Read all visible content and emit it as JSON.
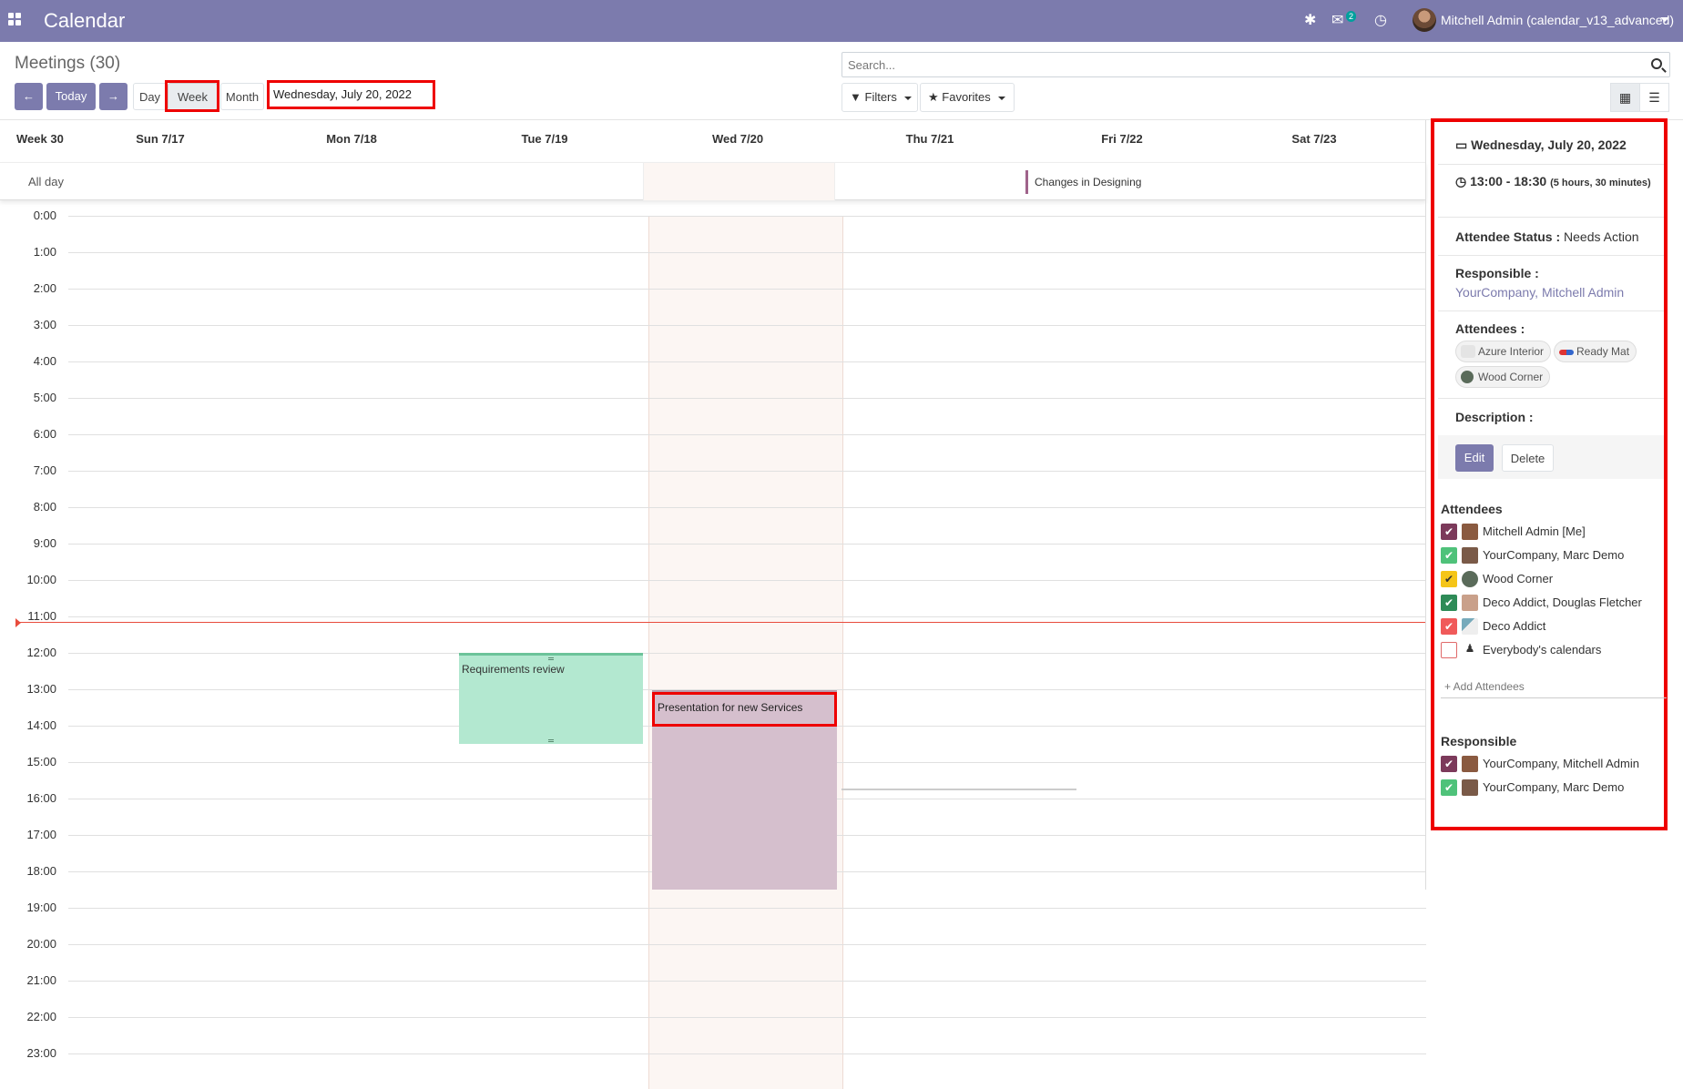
{
  "topbar": {
    "app_name": "Calendar",
    "chat_count": "2",
    "user_name": "Mitchell Admin (calendar_v13_advanced)"
  },
  "control_panel": {
    "title": "Meetings (30)",
    "today_label": "Today",
    "view_day": "Day",
    "view_week": "Week",
    "view_month": "Month",
    "current_date": "Wednesday, July 20, 2022",
    "search_placeholder": "Search...",
    "filters_label": "Filters",
    "favorites_label": "Favorites"
  },
  "calendar": {
    "week_label": "Week 30",
    "days": [
      "Sun 7/17",
      "Mon 7/18",
      "Tue 7/19",
      "Wed 7/20",
      "Thu 7/21",
      "Fri 7/22",
      "Sat 7/23"
    ],
    "allday_label": "All day",
    "allday_event": "Changes in Designing",
    "hours": [
      "0:00",
      "1:00",
      "2:00",
      "3:00",
      "4:00",
      "5:00",
      "6:00",
      "7:00",
      "8:00",
      "9:00",
      "10:00",
      "11:00",
      "12:00",
      "13:00",
      "14:00",
      "15:00",
      "16:00",
      "17:00",
      "18:00",
      "19:00",
      "20:00",
      "21:00",
      "22:00",
      "23:00"
    ],
    "events": {
      "green": "Requirements review",
      "purple": "Presentation for new Services"
    }
  },
  "popover": {
    "date": "Wednesday, July 20, 2022",
    "time": "13:00 - 18:30",
    "duration": "(5 hours, 30 minutes)",
    "status_label": "Attendee Status :",
    "status_value": "Needs Action",
    "responsible_label": "Responsible :",
    "responsible_value": "YourCompany, Mitchell Admin",
    "attendees_label": "Attendees :",
    "attendee_tags": [
      "Azure Interior",
      "Ready Mat",
      "Wood Corner"
    ],
    "description_label": "Description :",
    "edit_label": "Edit",
    "delete_label": "Delete"
  },
  "sidebar": {
    "attendees_title": "Attendees",
    "attendees": [
      {
        "name": "Mitchell Admin [Me]",
        "color": "#7c3a5b"
      },
      {
        "name": "YourCompany, Marc Demo",
        "color": "#4fc27a"
      },
      {
        "name": "Wood Corner",
        "color": "#f5c518"
      },
      {
        "name": "Deco Addict, Douglas Fletcher",
        "color": "#2e8b57"
      },
      {
        "name": "Deco Addict",
        "color": "#f05a5a"
      },
      {
        "name": "Everybody's calendars",
        "color": "#ffffff"
      }
    ],
    "add_attendees": "+ Add Attendees",
    "responsible_title": "Responsible",
    "responsible": [
      {
        "name": "YourCompany, Mitchell Admin",
        "color": "#7c3a5b"
      },
      {
        "name": "YourCompany, Marc Demo",
        "color": "#4fc27a"
      }
    ]
  }
}
